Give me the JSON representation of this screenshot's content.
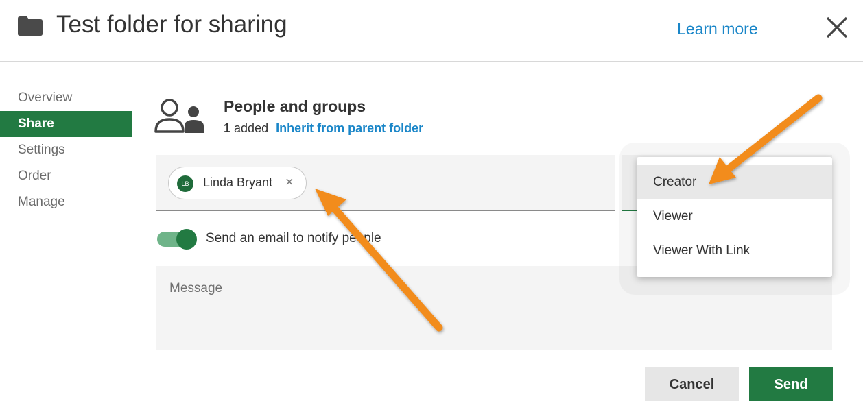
{
  "header": {
    "title": "Test folder for sharing",
    "learn_more": "Learn more"
  },
  "sidebar": {
    "items": [
      {
        "label": "Overview"
      },
      {
        "label": "Share",
        "active": true
      },
      {
        "label": "Settings"
      },
      {
        "label": "Order"
      },
      {
        "label": "Manage"
      }
    ]
  },
  "people_groups": {
    "title": "People and groups",
    "added_count": "1",
    "added_label": "added",
    "inherit_link": "Inherit from parent folder"
  },
  "chip": {
    "initials": "LB",
    "name": "Linda Bryant",
    "remove": "×"
  },
  "notify": {
    "label": "Send an email to notify people",
    "enabled": true
  },
  "message": {
    "placeholder": "Message"
  },
  "buttons": {
    "cancel": "Cancel",
    "send": "Send"
  },
  "role_dropdown": {
    "options": [
      "Creator",
      "Viewer",
      "Viewer With Link"
    ],
    "highlighted": "Creator"
  },
  "colors": {
    "accent": "#227a42",
    "link": "#1a86c8",
    "annotation_arrow": "#f28c1b"
  }
}
